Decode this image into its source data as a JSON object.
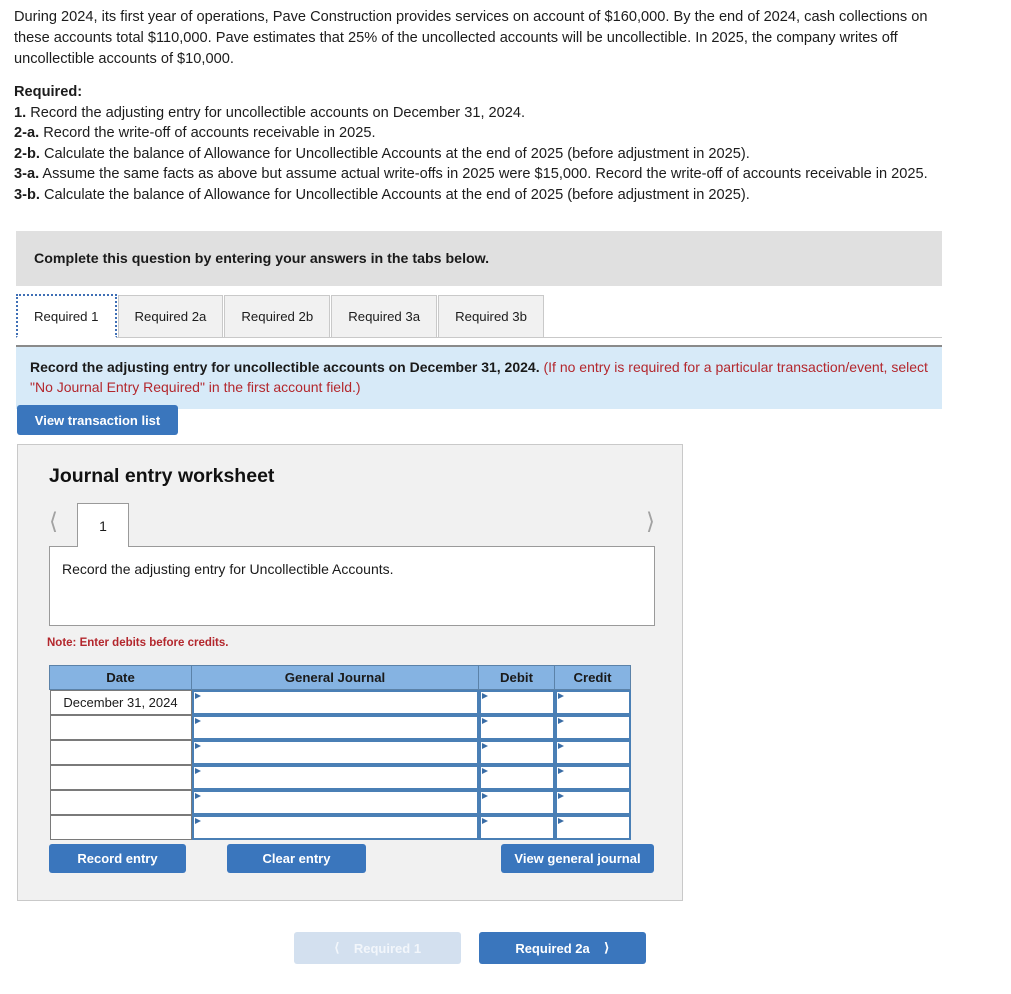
{
  "problem": {
    "text": "During 2024, its first year of operations, Pave Construction provides services on account of $160,000. By the end of 2024, cash collections on these accounts total $110,000. Pave estimates that 25% of the uncollected accounts will be uncollectible. In 2025, the company writes off uncollectible accounts of $10,000."
  },
  "required": {
    "heading": "Required:",
    "items": [
      {
        "num": "1.",
        "text": " Record the adjusting entry for uncollectible accounts on December 31, 2024."
      },
      {
        "num": "2-a.",
        "text": " Record the write-off of accounts receivable in 2025."
      },
      {
        "num": "2-b.",
        "text": " Calculate the balance of Allowance for Uncollectible Accounts at the end of 2025 (before adjustment in 2025)."
      },
      {
        "num": "3-a.",
        "text": " Assume the same facts as above but assume actual write-offs in 2025 were $15,000. Record the write-off of accounts receivable in 2025."
      },
      {
        "num": "3-b.",
        "text": " Calculate the balance of Allowance for Uncollectible Accounts at the end of 2025 (before adjustment in 2025)."
      }
    ]
  },
  "prompt_band": {
    "text": "Complete this question by entering your answers in the tabs below."
  },
  "tabs": [
    {
      "label": "Required 1",
      "active": true
    },
    {
      "label": "Required 2a",
      "active": false
    },
    {
      "label": "Required 2b",
      "active": false
    },
    {
      "label": "Required 3a",
      "active": false
    },
    {
      "label": "Required 3b",
      "active": false
    }
  ],
  "instruction": {
    "main": "Record the adjusting entry for uncollectible accounts on December 31, 2024.",
    "note": "(If no entry is required for a particular transaction/event, select \"No Journal Entry Required\" in the first account field.)"
  },
  "buttons": {
    "view_transaction_list": "View transaction list",
    "record_entry": "Record entry",
    "clear_entry": "Clear entry",
    "view_general_journal": "View general journal"
  },
  "worksheet": {
    "title": "Journal entry worksheet",
    "pager": {
      "prev_icon": "chevron-left-icon",
      "next_icon": "chevron-right-icon",
      "current_page": "1"
    },
    "description": "Record the adjusting entry for Uncollectible Accounts.",
    "note": "Note: Enter debits before credits.",
    "table": {
      "headers": [
        "Date",
        "General Journal",
        "Debit",
        "Credit"
      ],
      "rows": [
        {
          "date": "December 31, 2024",
          "general_journal": "",
          "debit": "",
          "credit": ""
        },
        {
          "date": "",
          "general_journal": "",
          "debit": "",
          "credit": ""
        },
        {
          "date": "",
          "general_journal": "",
          "debit": "",
          "credit": ""
        },
        {
          "date": "",
          "general_journal": "",
          "debit": "",
          "credit": ""
        },
        {
          "date": "",
          "general_journal": "",
          "debit": "",
          "credit": ""
        },
        {
          "date": "",
          "general_journal": "",
          "debit": "",
          "credit": ""
        }
      ]
    }
  },
  "nav": {
    "prev_label": "Required 1",
    "prev_icon": "chevron-left-icon",
    "next_label": "Required 2a",
    "next_icon": "chevron-right-icon"
  },
  "colors": {
    "accent_blue": "#3a76bd",
    "table_header_blue": "#85b3e2",
    "instruction_bg": "#d7eaf8",
    "prompt_band_bg": "#e0e0e0",
    "panel_bg": "#f1f1f1",
    "note_red": "#b3272d"
  }
}
